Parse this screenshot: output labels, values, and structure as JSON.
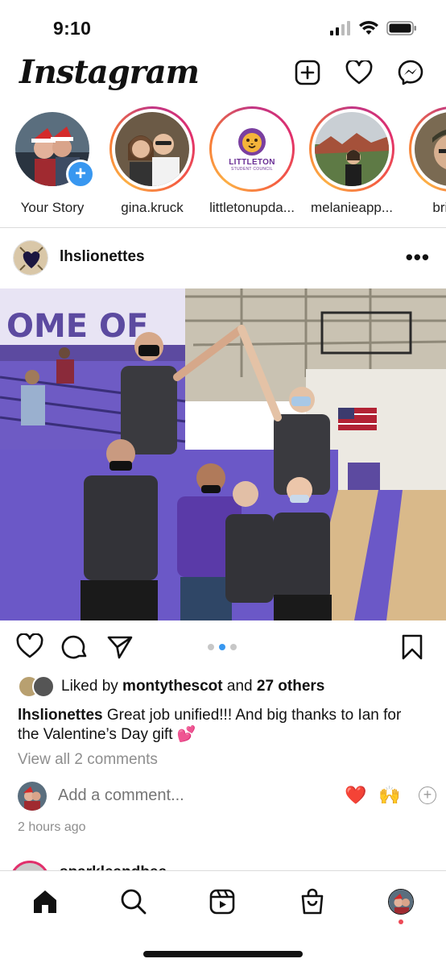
{
  "status_bar": {
    "time": "9:10"
  },
  "header": {
    "logo": "Instagram"
  },
  "stories": [
    {
      "name": "Your Story",
      "ring": false,
      "own": true
    },
    {
      "name": "gina.kruck",
      "ring": true
    },
    {
      "name": "littletonupda...",
      "ring": true,
      "logo_text": "LITTLETON",
      "logo_sub": "STUDENT COUNCIL"
    },
    {
      "name": "melanieapp...",
      "ring": true
    },
    {
      "name": "brian_",
      "ring": true
    }
  ],
  "post": {
    "username": "lhslionettes",
    "more": "•••",
    "carousel": {
      "count": 3,
      "active": 2
    },
    "likes": {
      "prefix": "Liked by ",
      "user": "montythescot",
      "middle": " and ",
      "others": "27 others"
    },
    "caption": {
      "username": "lhslionettes",
      "text": " Great job unified!!! And big thanks to Ian for the Valentine’s Day gift 💕"
    },
    "view_comments": "View all 2 comments",
    "add_comment_placeholder": "Add a comment...",
    "quick_reactions": [
      "❤️",
      "🙌"
    ],
    "plus": "+",
    "timestamp": "2 hours ago"
  },
  "next_post": {
    "username": "sparkleandbee"
  },
  "colors": {
    "accent": "#3897f0",
    "notification": "#ed4956",
    "heart": "#e0245e"
  }
}
